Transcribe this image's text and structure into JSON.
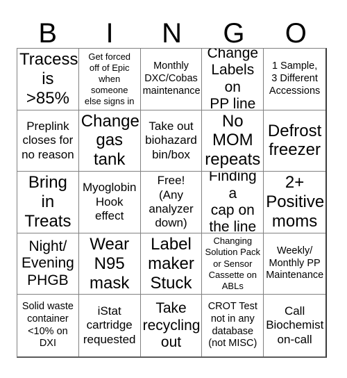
{
  "card": {
    "title": "BINGO",
    "header_letters": [
      "B",
      "I",
      "N",
      "G",
      "O"
    ],
    "columns": 5,
    "rows": 5,
    "background_color": "#ffffff",
    "border_color": "#808080",
    "text_color": "#000000",
    "cells": [
      {
        "row": 1,
        "col": 1,
        "letter": "B",
        "text": "Tracess\nis\n>85%",
        "size": "xl"
      },
      {
        "row": 1,
        "col": 2,
        "letter": "I",
        "text": "Get forced\noff of Epic\nwhen\nsomeone\nelse signs in",
        "size": "xs"
      },
      {
        "row": 1,
        "col": 3,
        "letter": "N",
        "text": "Monthly\nDXC/Cobas\nmaintenance",
        "size": "sm"
      },
      {
        "row": 1,
        "col": 4,
        "letter": "G",
        "text": "Change\nLabels on\nPP line",
        "size": "lg"
      },
      {
        "row": 1,
        "col": 5,
        "letter": "O",
        "text": "1 Sample,\n3 Different\nAccessions",
        "size": "sm"
      },
      {
        "row": 2,
        "col": 1,
        "letter": "B",
        "text": "Preplink\ncloses for\nno reason",
        "size": "md"
      },
      {
        "row": 2,
        "col": 2,
        "letter": "I",
        "text": "Change\ngas\ntank",
        "size": "xl"
      },
      {
        "row": 2,
        "col": 3,
        "letter": "N",
        "text": "Take out\nbiohazard\nbin/box",
        "size": "md"
      },
      {
        "row": 2,
        "col": 4,
        "letter": "G",
        "text": "No\nMOM\nrepeats",
        "size": "xl"
      },
      {
        "row": 2,
        "col": 5,
        "letter": "O",
        "text": "Defrost\nfreezer",
        "size": "xl"
      },
      {
        "row": 3,
        "col": 1,
        "letter": "B",
        "text": "Bring\nin\nTreats",
        "size": "xl"
      },
      {
        "row": 3,
        "col": 2,
        "letter": "I",
        "text": "Myoglobin\nHook\neffect",
        "size": "md"
      },
      {
        "row": 3,
        "col": 3,
        "letter": "N",
        "text": "Free!\n(Any\nanalyzer\ndown)",
        "size": "md"
      },
      {
        "row": 3,
        "col": 4,
        "letter": "G",
        "text": "Finding a\ncap on\nthe line",
        "size": "lg"
      },
      {
        "row": 3,
        "col": 5,
        "letter": "O",
        "text": "2+\nPositive\nmoms",
        "size": "xl"
      },
      {
        "row": 4,
        "col": 1,
        "letter": "B",
        "text": "Night/\nEvening\nPHGB",
        "size": "lg"
      },
      {
        "row": 4,
        "col": 2,
        "letter": "I",
        "text": "Wear\nN95\nmask",
        "size": "xl"
      },
      {
        "row": 4,
        "col": 3,
        "letter": "N",
        "text": "Label\nmaker\nStuck",
        "size": "xl"
      },
      {
        "row": 4,
        "col": 4,
        "letter": "G",
        "text": "Changing\nSolution Pack\nor Sensor\nCassette on\nABLs",
        "size": "xs"
      },
      {
        "row": 4,
        "col": 5,
        "letter": "O",
        "text": "Weekly/\nMonthly PP\nMaintenance",
        "size": "sm"
      },
      {
        "row": 5,
        "col": 1,
        "letter": "B",
        "text": "Solid waste\ncontainer\n<10% on\nDXI",
        "size": "sm"
      },
      {
        "row": 5,
        "col": 2,
        "letter": "I",
        "text": "iStat\ncartridge\nrequested",
        "size": "md"
      },
      {
        "row": 5,
        "col": 3,
        "letter": "N",
        "text": "Take\nrecycling\nout",
        "size": "lg"
      },
      {
        "row": 5,
        "col": 4,
        "letter": "G",
        "text": "CROT Test\nnot in any\ndatabase\n(not MISC)",
        "size": "sm"
      },
      {
        "row": 5,
        "col": 5,
        "letter": "O",
        "text": "Call\nBiochemist\non-call",
        "size": "md"
      }
    ]
  }
}
